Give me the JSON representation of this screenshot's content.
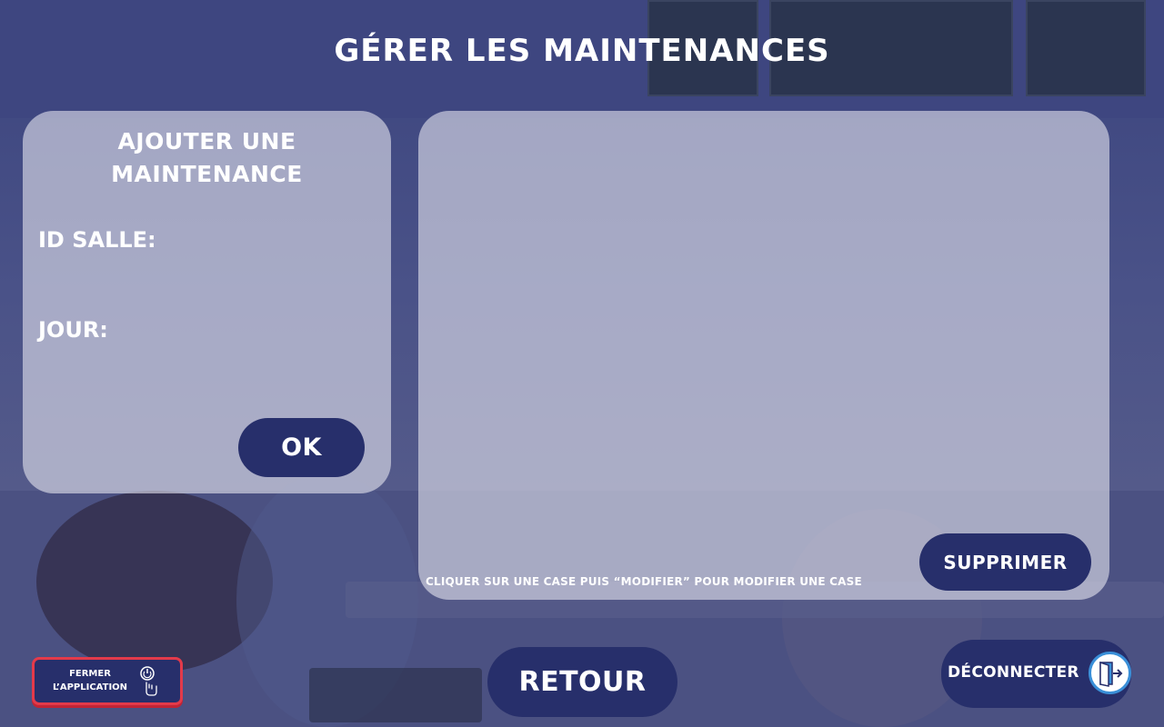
{
  "page": {
    "title": "GÉRER LES MAINTENANCES"
  },
  "add_panel": {
    "title_line1": "AJOUTER UNE",
    "title_line2": "MAINTENANCE",
    "id_salle_label": "ID SALLE:",
    "id_salle_value": "",
    "jour_label": "JOUR:",
    "jour_value": "",
    "ok_label": "OK"
  },
  "list_panel": {
    "hint": "CLIQUER SUR UNE CASE PUIS “MODIFIER” POUR MODIFIER UNE CASE",
    "delete_label": "SUPPRIMER"
  },
  "footer": {
    "close_app_line1": "FERMER",
    "close_app_line2": "L’APPLICATION",
    "close_app_icon": "power-hand-icon",
    "back_label": "RETOUR",
    "logout_label": "DÉCONNECTER",
    "logout_icon": "exit-door-icon"
  },
  "colors": {
    "button": "#272f6b",
    "panel": "#e1e1eb",
    "close_border": "#e33a4a",
    "logout_icon_ring": "#3a8fd8"
  }
}
